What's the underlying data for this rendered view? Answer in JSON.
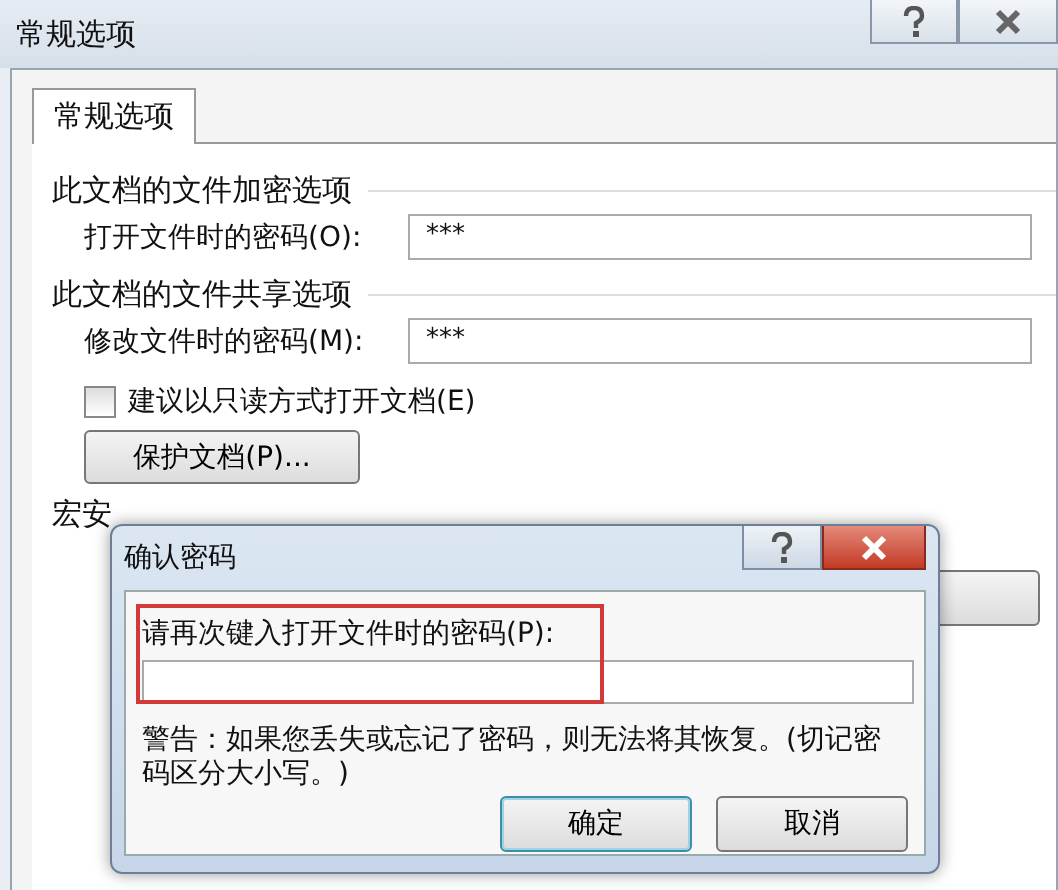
{
  "window": {
    "title": "常规选项"
  },
  "tabs": [
    {
      "label": "常规选项",
      "selected": true
    }
  ],
  "encryption": {
    "heading": "此文档的文件加密选项",
    "label": "打开文件时的密码(O):",
    "value": "***"
  },
  "sharing": {
    "heading": "此文档的文件共享选项",
    "label": "修改文件时的密码(M):",
    "value": "***",
    "readonly_checkbox": {
      "label": "建议以只读方式打开文档(E)",
      "checked": false
    },
    "protect_button": "保护文档(P)..."
  },
  "macro": {
    "heading": "宏安"
  },
  "confirm_dialog": {
    "title": "确认密码",
    "prompt": "请再次键入打开文件时的密码(P):",
    "warning": "警告：如果您丢失或忘记了密码，则无法将其恢复。(切记密码区分大小写。)",
    "buttons": [
      {
        "label": "确定",
        "kind": "default"
      },
      {
        "label": "取消",
        "kind": "normal"
      }
    ]
  }
}
